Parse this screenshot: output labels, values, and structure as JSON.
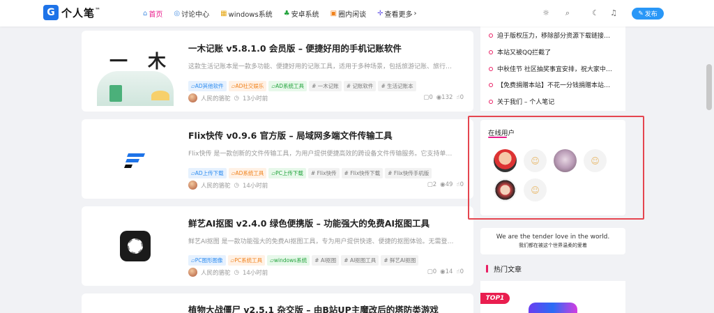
{
  "header": {
    "logo_mark": "G",
    "logo_text": "个人笔",
    "logo_suffix": "™",
    "nav": [
      {
        "label": "首页",
        "icon": "home-icon",
        "glyph": "⌂",
        "color": "#4a90e2"
      },
      {
        "label": "讨论中心",
        "icon": "chat-icon",
        "glyph": "◎",
        "color": "#4a90e2"
      },
      {
        "label": "windows系统",
        "icon": "windows-icon",
        "glyph": "▦",
        "color": "#e6a817"
      },
      {
        "label": "安卓系统",
        "icon": "android-icon",
        "glyph": "♣",
        "color": "#21a33b"
      },
      {
        "label": "圈内闲谈",
        "icon": "folder-icon",
        "glyph": "▣",
        "color": "#f0811a"
      },
      {
        "label": "查看更多",
        "icon": "more-icon",
        "glyph": "✛",
        "color": "#6c5ce7",
        "suffix": "›"
      }
    ],
    "publish_label": "发布",
    "publish_icon": "✎"
  },
  "posts": [
    {
      "title": "一木记账 v5.8.1.0 会员版 – 便捷好用的手机记账软件",
      "desc": "这款生活记账本是一款多功能、便捷好用的记账工具，适用于多种场景，包括旅游记账、旅行…",
      "tags": [
        {
          "label": "AD其他软件",
          "style": "blue",
          "icon": "▱"
        },
        {
          "label": "AD社交娱乐",
          "style": "orange",
          "icon": "▱"
        },
        {
          "label": "AD系统工具",
          "style": "green",
          "icon": "▱"
        },
        {
          "label": "一木记账",
          "style": "gray",
          "icon": "#"
        },
        {
          "label": "记账软件",
          "style": "gray",
          "icon": "#"
        },
        {
          "label": "生活记账本",
          "style": "gray",
          "icon": "#"
        }
      ],
      "author": "人民的骆驼",
      "time": "13小时前",
      "comments": "0",
      "views": "132",
      "likes": "0",
      "thumb_text": "一 木"
    },
    {
      "title": "Flix快传 v0.9.6 官方版 – 局域网多端文件传输工具",
      "desc": "Flix快传 是一款创新的文件传输工具，为用户提供便捷高效的跨设备文件传输服务。它支持单…",
      "tags": [
        {
          "label": "AD上传下载",
          "style": "blue",
          "icon": "▱"
        },
        {
          "label": "AD系统工具",
          "style": "orange",
          "icon": "▱"
        },
        {
          "label": "PC上传下载",
          "style": "green",
          "icon": "▱"
        },
        {
          "label": "Flix快传",
          "style": "gray",
          "icon": "#"
        },
        {
          "label": "Flix快传下载",
          "style": "gray",
          "icon": "#"
        },
        {
          "label": "Flix快传手机版",
          "style": "gray",
          "icon": "#"
        }
      ],
      "author": "人民的骆驼",
      "time": "14小时前",
      "comments": "2",
      "views": "49",
      "likes": "0"
    },
    {
      "title": "鲜艺AI抠图 v2.4.0 绿色便携版 – 功能强大的免费AI抠图工具",
      "desc": "鲜艺AI抠图 是一款功能强大的免费AI抠图工具，专为用户提供快速、便捷的抠图体验。无需登…",
      "tags": [
        {
          "label": "PC图形图像",
          "style": "blue",
          "icon": "▱"
        },
        {
          "label": "PC系统工具",
          "style": "orange",
          "icon": "▱"
        },
        {
          "label": "windows系统",
          "style": "green",
          "icon": "▱"
        },
        {
          "label": "AI抠图",
          "style": "gray",
          "icon": "#"
        },
        {
          "label": "AI抠图工具",
          "style": "gray",
          "icon": "#"
        },
        {
          "label": "鲜艺AI抠图",
          "style": "gray",
          "icon": "#"
        }
      ],
      "author": "人民的骆驼",
      "time": "14小时前",
      "comments": "0",
      "views": "14",
      "likes": "0"
    },
    {
      "title": "植物大战僵尸 v2.5.1 杂交版 – 由B站UP主魔改后的塔防类游戏"
    }
  ],
  "sidebar": {
    "news": [
      "迫于版权压力，移除部分资源下载链接…",
      "本站又被QQ拦截了",
      "中秋佳节 社区抽奖事宜安排，祝大家中…",
      "【免费捐赠本站】不花一分钱捐赠本站…",
      "关于我们 – 个人笔记"
    ],
    "online_title": "在线用户",
    "online_users": [
      "avatar-1",
      "avatar-2",
      "avatar-3",
      "avatar-4",
      "avatar-5",
      "avatar-6"
    ],
    "quote_en": "We are the tender love in the world.",
    "quote_cn": "我们都在被这个世界温柔的爱着",
    "hot_title": "热门文章",
    "top_badge": "TOP1"
  },
  "colors": {
    "accent": "#e91e8c",
    "primary": "#2997f7",
    "highlight": "#e5454f"
  }
}
